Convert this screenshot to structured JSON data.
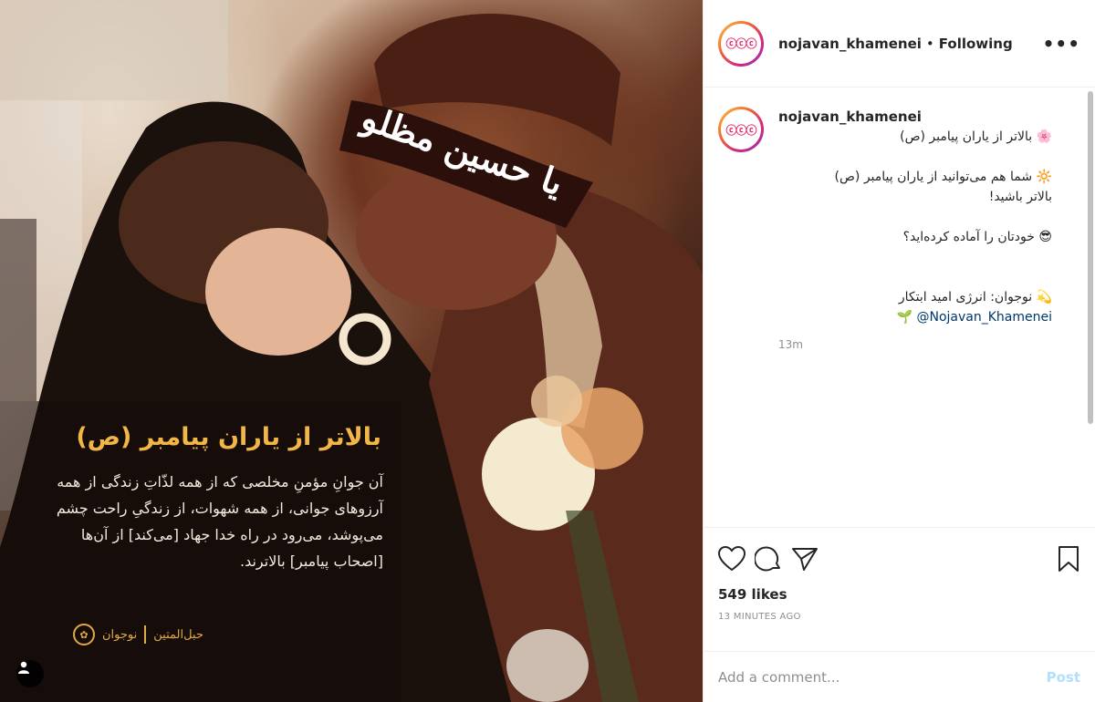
{
  "post": {
    "headband_text": "یا حسین مظلوم",
    "overlay_title": "بالاتر از یاران پیامبر (ص)",
    "overlay_quote": "آن جوانِ مؤمنِ مخلصی که از همه لذّاتِ زندگی از همه آرزوهای جوانی، از همه شهوات، از زندگیِ راحت چشم می‌پوشد، می‌رود در راه خدا جهاد [می‌کند] از آن‌ها [اصحاب پیامبر] بالاترند.",
    "overlay_logo_left": "نوجوان",
    "overlay_logo_right": "حبل‌المتین"
  },
  "header": {
    "avatar_text": "ⓒⓒⓒ",
    "username": "nojavan_khamenei",
    "separator": "•",
    "follow_status": "Following",
    "more": "•••"
  },
  "caption": {
    "username": "nojavan_khamenei",
    "lines": [
      {
        "emoji": "🌸",
        "text": "بالاتر از یاران پیامبر (ص)"
      },
      {
        "gap": true
      },
      {
        "emoji": "🔆",
        "text": "شما هم می‌توانید از یاران پیامبر (ص)"
      },
      {
        "emoji": "",
        "text": "بالاتر باشید!"
      },
      {
        "gap": true
      },
      {
        "emoji": "😎",
        "text": "خودتان را آماده کرده‌اید؟"
      },
      {
        "gap": true
      },
      {
        "gap": true
      },
      {
        "emoji": "💫",
        "text": "نوجوان: انرژی امید ابتکار"
      },
      {
        "emoji": "🌱",
        "text": "@Nojavan_Khamenei",
        "mention": true
      }
    ],
    "timestamp": "13m"
  },
  "actions": {
    "like_icon": "heart-icon",
    "comment_icon": "comment-icon",
    "share_icon": "share-icon",
    "save_icon": "bookmark-icon",
    "likes": "549 likes",
    "ago": "13 MINUTES AGO"
  },
  "comment": {
    "placeholder": "Add a comment...",
    "post_label": "Post"
  },
  "colors": {
    "accent_title": "#f2b646",
    "post_button": "#b2dffc",
    "mention": "#00376b"
  }
}
